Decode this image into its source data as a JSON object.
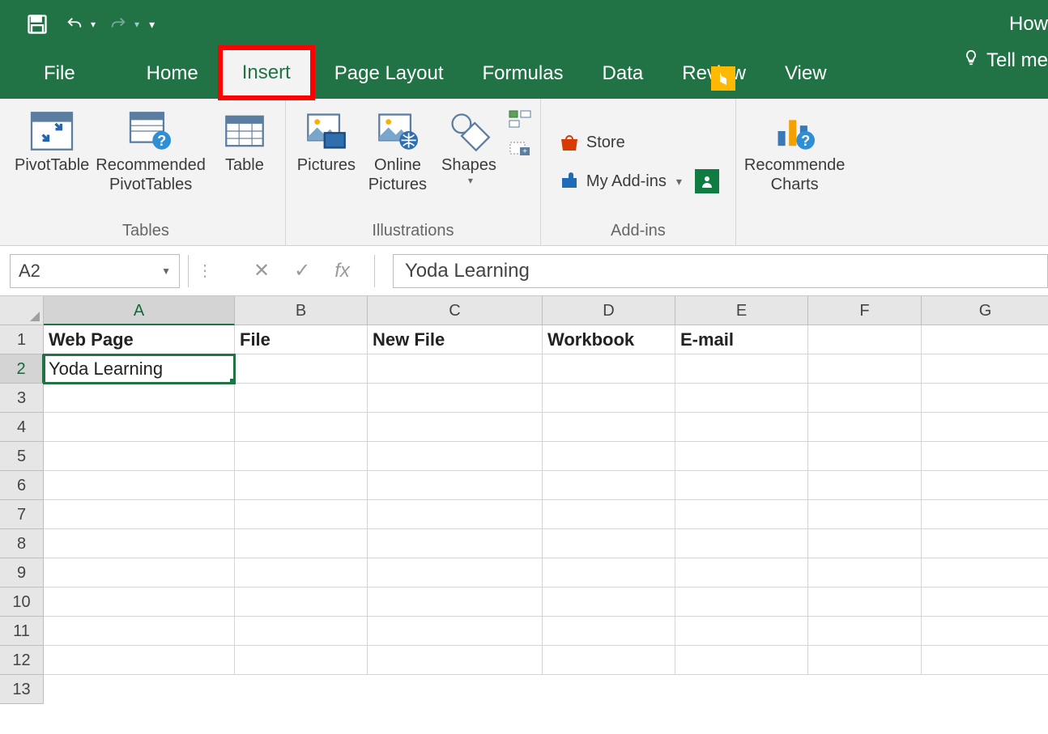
{
  "titlebar": {
    "right_text": "How"
  },
  "tabs": {
    "file": "File",
    "home": "Home",
    "insert": "Insert",
    "page_layout": "Page Layout",
    "formulas": "Formulas",
    "data": "Data",
    "review": "Review",
    "view": "View",
    "tell_me": "Tell me",
    "active": "insert"
  },
  "ribbon": {
    "tables": {
      "pivot": "PivotTable",
      "rec_pivot": "Recommended\nPivotTables",
      "table": "Table",
      "label": "Tables"
    },
    "illustrations": {
      "pictures": "Pictures",
      "online_pictures": "Online\nPictures",
      "shapes": "Shapes",
      "label": "Illustrations"
    },
    "addins": {
      "store": "Store",
      "my_addins": "My Add-ins",
      "label": "Add-ins"
    },
    "charts": {
      "rec_charts": "Recommende\nCharts"
    }
  },
  "formula_bar": {
    "name_box": "A2",
    "fx": "fx",
    "value": "Yoda Learning"
  },
  "grid": {
    "columns": [
      "A",
      "B",
      "C",
      "D",
      "E",
      "F",
      "G"
    ],
    "rows": [
      1,
      2,
      3,
      4,
      5,
      6,
      7,
      8,
      9,
      10,
      11,
      12
    ],
    "selected_col_index": 0,
    "selected_row_index": 1,
    "cells": {
      "A1": "Web Page",
      "B1": "File",
      "C1": "New File",
      "D1": "Workbook",
      "E1": "E-mail",
      "A2": "Yoda Learning"
    }
  }
}
